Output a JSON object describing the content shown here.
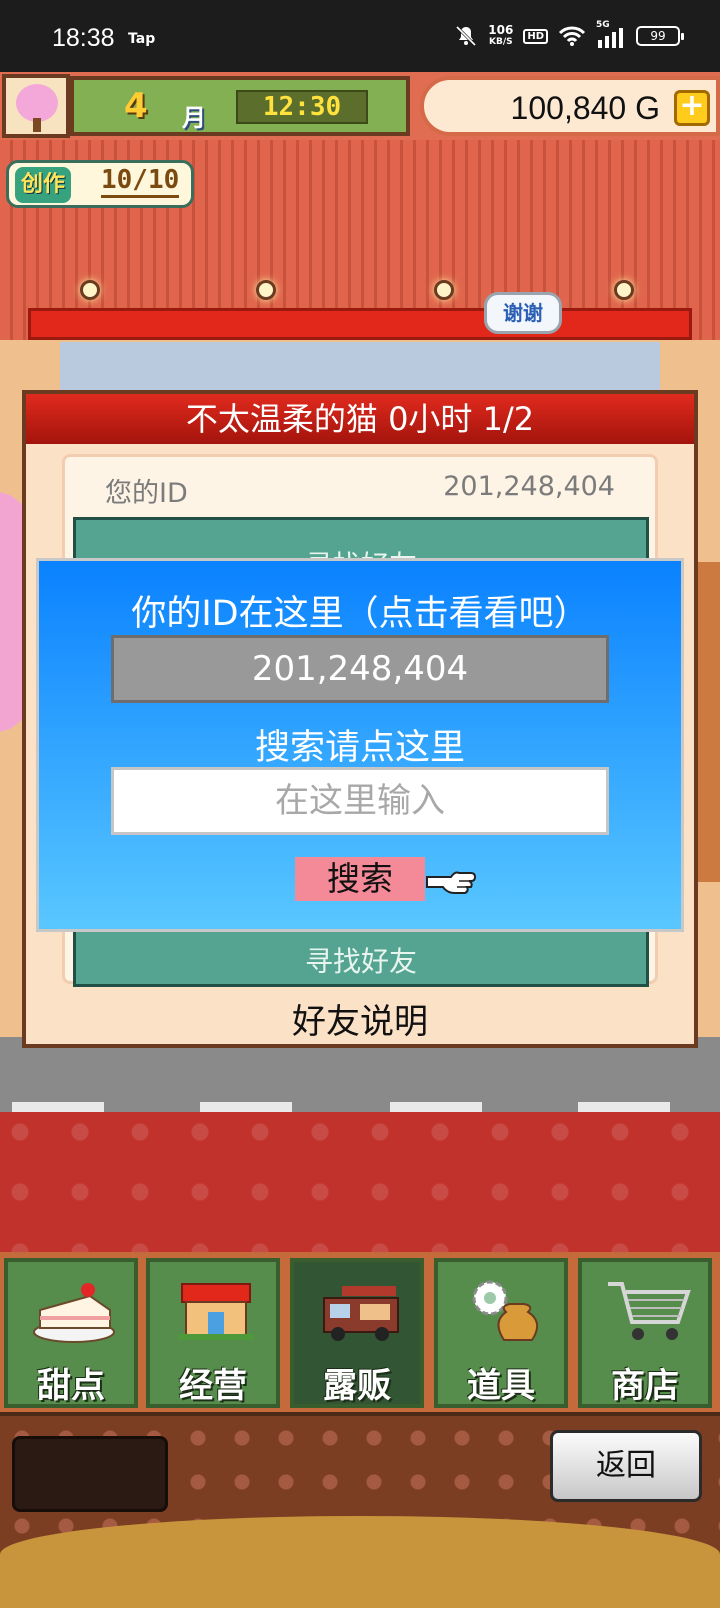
{
  "status_bar": {
    "time": "18:38",
    "app_badge": "Tap",
    "net_speed_value": "106",
    "net_speed_unit": "KB/S",
    "hd_label": "HD",
    "signal_label": "5G",
    "battery": "99"
  },
  "hud": {
    "month_number": "4",
    "month_unit": "月",
    "clock": "12:30",
    "gold": "100,840 G",
    "gold_add": "+",
    "craft_label": "创作",
    "craft_count": "10/10"
  },
  "scene": {
    "thanks_bubble": "谢谢"
  },
  "friend_panel": {
    "header": "不太温柔的猫  0小时 1/2",
    "id_label": "您的ID",
    "id_value": "201,248,404",
    "teal_top_text": "寻找好友",
    "teal_bottom_text": "寻找好友",
    "explain": "好友说明"
  },
  "dialog": {
    "title": "你的ID在这里（点击看看吧）",
    "id_value": "201,248,404",
    "search_prompt": "搜索请点这里",
    "search_placeholder": "在这里输入",
    "search_button": "搜索"
  },
  "nav": {
    "items": [
      {
        "label": "甜点",
        "icon": "cake-icon"
      },
      {
        "label": "经营",
        "icon": "shop-icon"
      },
      {
        "label": "露贩",
        "icon": "food-truck-icon"
      },
      {
        "label": "道具",
        "icon": "items-icon"
      },
      {
        "label": "商店",
        "icon": "cart-icon"
      }
    ],
    "active_index": 2
  },
  "footer": {
    "back_button": "返回"
  },
  "colors": {
    "dialog_top": "#0a82ff",
    "dialog_bottom": "#59c7ff",
    "search_button": "#f48a98",
    "panel_header": "#e12a1e",
    "nav_item": "#568d4c",
    "nav_active": "#325533"
  }
}
